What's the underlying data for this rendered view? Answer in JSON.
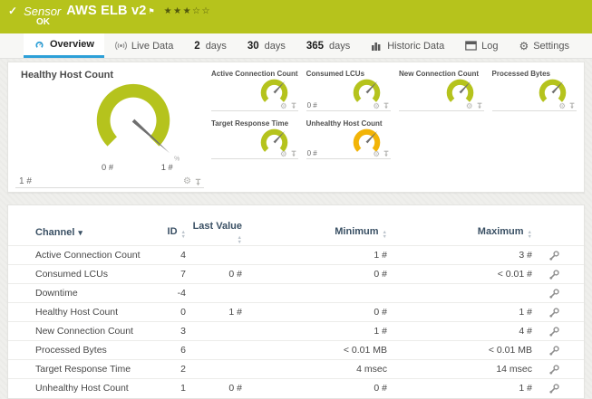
{
  "icons": {
    "check": "✓",
    "flag": "⚑",
    "gear": "⚙",
    "sort_down": "▾",
    "sort_up_small": "▲",
    "sort_down_small": "▼"
  },
  "header": {
    "kind": "Sensor",
    "title": "AWS ELB v2",
    "status": "OK",
    "stars_display": "★★★☆☆",
    "priority_stars_filled": 3,
    "priority_stars_total": 5,
    "bar_color": "#b6c31c"
  },
  "tabs": [
    {
      "label": "Overview",
      "icon": "gauge-icon",
      "active": true
    },
    {
      "label": "Live Data",
      "icon": "live-data-icon"
    },
    {
      "num": "2",
      "label": "days"
    },
    {
      "num": "30",
      "label": "days"
    },
    {
      "num": "365",
      "label": "days"
    },
    {
      "label": "Historic Data",
      "icon": "chart-icon"
    },
    {
      "label": "Log",
      "icon": "log-icon"
    },
    {
      "label": "Settings",
      "icon": "gear-icon"
    }
  ],
  "gauges": {
    "main": {
      "title": "Healthy Host Count",
      "value": "1 #",
      "scale_min": "0 #",
      "scale_max": "1 #",
      "unit": "%",
      "color": "#b5c31d"
    },
    "small": [
      {
        "title": "Active Connection Count",
        "value": "",
        "color": "#b5c31d"
      },
      {
        "title": "Consumed LCUs",
        "value": "0 #",
        "color": "#b5c31d"
      },
      {
        "title": "New Connection Count",
        "value": "",
        "color": "#b5c31d"
      },
      {
        "title": "Processed Bytes",
        "value": "",
        "color": "#b5c31d"
      },
      {
        "title": "Target Response Time",
        "value": "",
        "color": "#b5c31d"
      },
      {
        "title": "Unhealthy Host Count",
        "value": "0 #",
        "color": "#f2b407"
      }
    ]
  },
  "table": {
    "columns": [
      {
        "label": "Channel",
        "sorted": true
      },
      {
        "label": "ID"
      },
      {
        "label": "Last Value"
      },
      {
        "label": "Minimum"
      },
      {
        "label": "Maximum"
      }
    ],
    "rows": [
      {
        "channel": "Active Connection Count",
        "id": "4",
        "last": "",
        "min": "1 #",
        "max": "3 #"
      },
      {
        "channel": "Consumed LCUs",
        "id": "7",
        "last": "0 #",
        "min": "0 #",
        "max": "< 0.01 #"
      },
      {
        "channel": "Downtime",
        "id": "-4",
        "last": "",
        "min": "",
        "max": ""
      },
      {
        "channel": "Healthy Host Count",
        "id": "0",
        "last": "1 #",
        "min": "0 #",
        "max": "1 #"
      },
      {
        "channel": "New Connection Count",
        "id": "3",
        "last": "",
        "min": "1 #",
        "max": "4 #"
      },
      {
        "channel": "Processed Bytes",
        "id": "6",
        "last": "",
        "min": "< 0.01 MB",
        "max": "< 0.01 MB"
      },
      {
        "channel": "Target Response Time",
        "id": "2",
        "last": "",
        "min": "4 msec",
        "max": "14 msec"
      },
      {
        "channel": "Unhealthy Host Count",
        "id": "1",
        "last": "0 #",
        "min": "0 #",
        "max": "1 #"
      }
    ]
  }
}
